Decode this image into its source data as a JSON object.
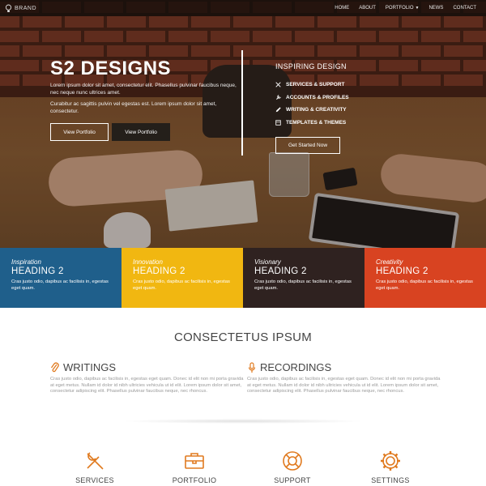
{
  "navbar": {
    "brand": "BRAND",
    "items": [
      {
        "label": "HOME"
      },
      {
        "label": "ABOUT"
      },
      {
        "label": "PORTFOLIO"
      },
      {
        "label": "NEWS"
      },
      {
        "label": "CONTACT"
      }
    ]
  },
  "hero": {
    "title": "S2 DESIGNS",
    "paragraph1": "Lorem ipsum dolor sit amet, consectetur elit. Phasellus pulvinar faucibus neque, nec neque nunc ultrices amet.",
    "paragraph2": "Curabitur ac sagittis pulvin vel egestas est. Lorem ipsum dolor sit amet, consectetur.",
    "button1": "View Portfolio",
    "button2": "View Portfolio",
    "right_title": "INSPIRING DESIGN",
    "features": [
      {
        "icon": "tools-icon",
        "label": "SERVICES & SUPPORT"
      },
      {
        "icon": "wrench-icon",
        "label": "ACCOUNTS & PROFILES"
      },
      {
        "icon": "pencil-icon",
        "label": "WRITING & CREATIVITY"
      },
      {
        "icon": "template-icon",
        "label": "TEMPLATES & THEMES"
      }
    ],
    "cta": "Get Started Now"
  },
  "boxes": [
    {
      "sub": "Inspiration",
      "heading": "HEADING 2",
      "text": "Cras justo odio, dapibus ac facilisis in, egestas eget quam.",
      "color": "#1f5f8b"
    },
    {
      "sub": "Innovation",
      "heading": "HEADING 2",
      "text": "Cras justo odio, dapibus ac facilisis in, egestas eget quam.",
      "color": "#f1b711"
    },
    {
      "sub": "Visionary",
      "heading": "HEADING 2",
      "text": "Cras justo odio, dapibus ac facilisis in, egestas eget quam.",
      "color": "#2f2220"
    },
    {
      "sub": "Creativity",
      "heading": "HEADING 2",
      "text": "Cras justo odio, dapibus ac facilisis in, egestas eget quam.",
      "color": "#d84321"
    }
  ],
  "section": {
    "title": "CONSECTETUS IPSUM",
    "columns": [
      {
        "heading": "WRITINGS",
        "icon": "paperclip-icon",
        "text": "Cras justo odio, dapibus ac facilisis in, egestas eget quam. Donec id elit non mi porta gravida at eget metus. Nullam id dolor id nibh ultricies vehicula ut id elit. Lorem ipsum dolor sit amet, consectetur adipiscing elit. Phasellus pulvinar faucibus neque, nec rhoncus."
      },
      {
        "heading": "RECORDINGS",
        "icon": "microphone-icon",
        "text": "Cras justo odio, dapibus ac facilisis in, egestas eget quam. Donec id elit non mi porta gravida at eget metus. Nullam id dolor id nibh ultricies vehicula ut id elit. Lorem ipsum dolor sit amet, consectetur adipiscing elit. Phasellus pulvinar faucibus neque, nec rhoncus."
      }
    ]
  },
  "services": [
    {
      "label": "SERVICES",
      "icon": "tools-icon"
    },
    {
      "label": "PORTFOLIO",
      "icon": "briefcase-icon"
    },
    {
      "label": "SUPPORT",
      "icon": "lifebuoy-icon"
    },
    {
      "label": "SETTINGS",
      "icon": "gear-icon"
    }
  ],
  "colors": {
    "accent": "#e07a1f"
  }
}
